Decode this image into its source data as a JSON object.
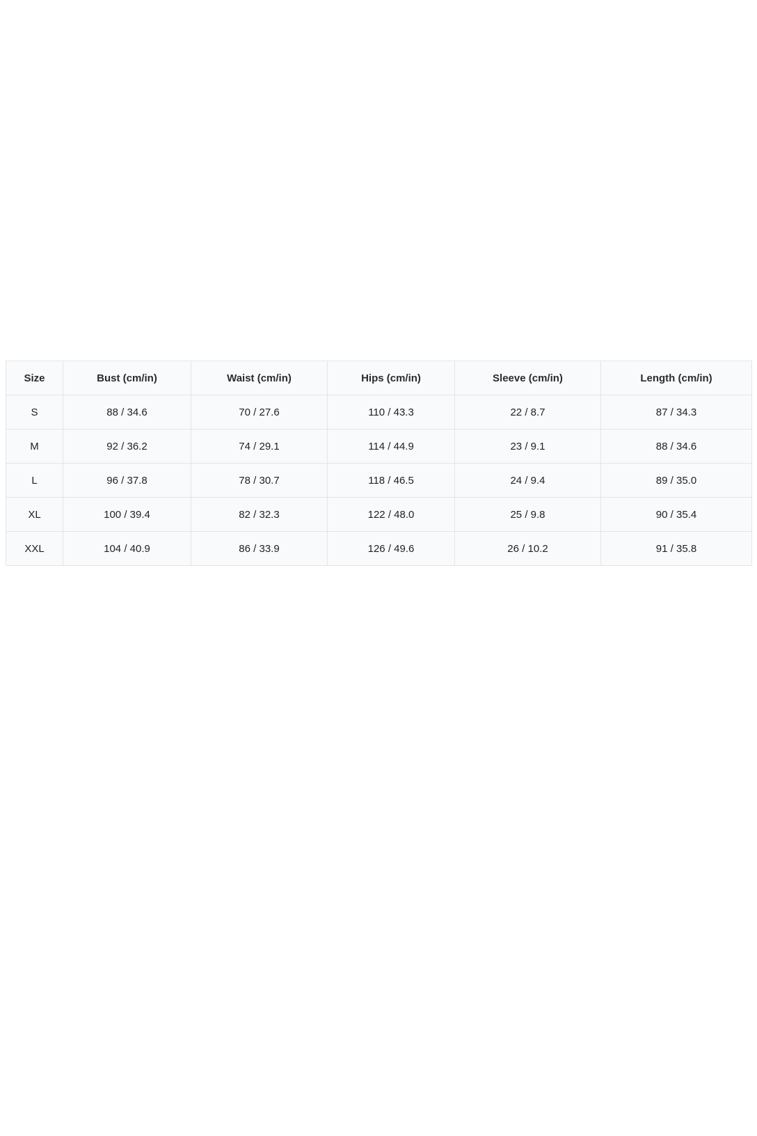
{
  "size_chart": {
    "headers": [
      "Size",
      "Bust (cm/in)",
      "Waist (cm/in)",
      "Hips (cm/in)",
      "Sleeve (cm/in)",
      "Length (cm/in)"
    ],
    "rows": [
      [
        "S",
        "88 / 34.6",
        "70 / 27.6",
        "110 / 43.3",
        "22 / 8.7",
        "87 / 34.3"
      ],
      [
        "M",
        "92 / 36.2",
        "74 / 29.1",
        "114 / 44.9",
        "23 / 9.1",
        "88 / 34.6"
      ],
      [
        "L",
        "96 / 37.8",
        "78 / 30.7",
        "118 / 46.5",
        "24 / 9.4",
        "89 / 35.0"
      ],
      [
        "XL",
        "100 / 39.4",
        "82 / 32.3",
        "122 / 48.0",
        "25 / 9.8",
        "90 / 35.4"
      ],
      [
        "XXL",
        "104 / 40.9",
        "86 / 33.9",
        "126 / 49.6",
        "26 / 10.2",
        "91 / 35.8"
      ]
    ]
  },
  "colors": {
    "table_background": "#f9fafb",
    "border": "#e3e5e8",
    "text": "#222222"
  }
}
